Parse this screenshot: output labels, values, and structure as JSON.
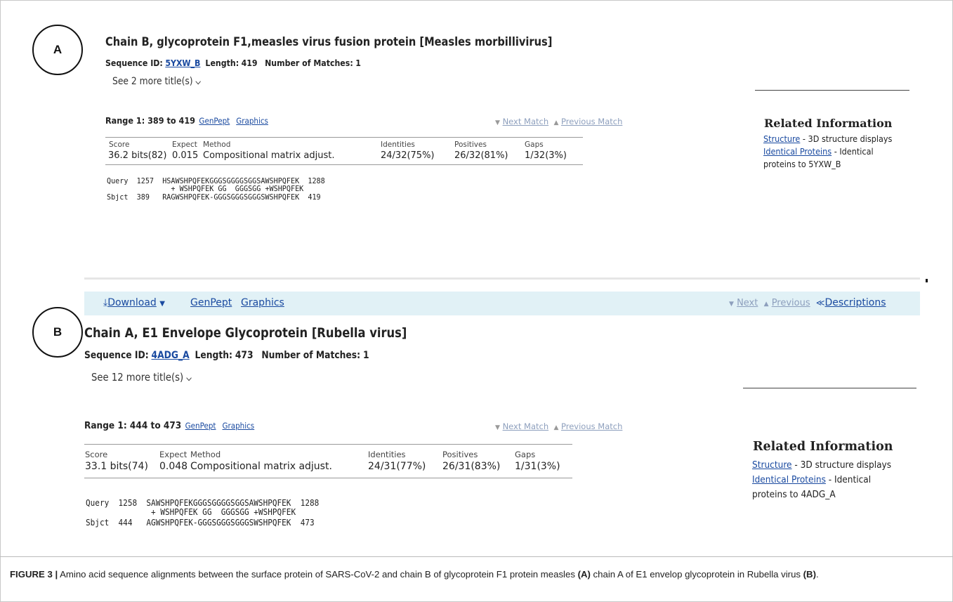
{
  "panel_a": {
    "label": "A",
    "title": "Chain B, glycoprotein F1,measles virus fusion protein [Measles morbillivirus]",
    "seq_id_label": "Sequence ID:",
    "seq_id": "5YXW_B",
    "length_label": "Length:",
    "length": "419",
    "matches_label": "Number of Matches:",
    "matches": "1",
    "see_more": "See 2 more title(s)",
    "range_label": "Range 1: 389 to 419",
    "genpept": "GenPept",
    "graphics": "Graphics",
    "next_match": "Next Match",
    "previous_match": "Previous Match",
    "stats_headers": [
      "Score",
      "Expect",
      "Method",
      "Identities",
      "Positives",
      "Gaps"
    ],
    "stats_values": [
      "36.2 bits(82)",
      "0.015",
      "Compositional matrix adjust.",
      "24/32(75%)",
      "26/32(81%)",
      "1/32(3%)"
    ],
    "alignment": [
      "Query  1257  HSAWSHPQFEKGGGSGGGGSGGSAWSHPQFEK  1288",
      "               + WSHPQFEK GG  GGGSGG +WSHPQFEK",
      "Sbjct  389   RAGWSHPQFEK-GGGSGGGSGGGSWSHPQFEK  419"
    ],
    "related_title": "Related Information",
    "related_structure": "Structure",
    "related_structure_desc": " - 3D structure displays",
    "related_identical": "Identical Proteins",
    "related_identical_desc": " - Identical",
    "related_identical_desc2": "proteins to 5YXW_B"
  },
  "toolbar": {
    "download": "Download",
    "genpept": "GenPept",
    "graphics": "Graphics",
    "next": "Next",
    "previous": "Previous",
    "descriptions": "Descriptions"
  },
  "panel_b": {
    "label": "B",
    "title": "Chain A, E1 Envelope Glycoprotein [Rubella virus]",
    "seq_id_label": "Sequence ID:",
    "seq_id": "4ADG_A",
    "length_label": "Length:",
    "length": "473",
    "matches_label": "Number of Matches:",
    "matches": "1",
    "see_more": "See 12 more title(s)",
    "range_label": "Range 1: 444 to 473",
    "genpept": "GenPept",
    "graphics": "Graphics",
    "next_match": "Next Match",
    "previous_match": "Previous Match",
    "stats_headers": [
      "Score",
      "Expect",
      "Method",
      "Identities",
      "Positives",
      "Gaps"
    ],
    "stats_values": [
      "33.1 bits(74)",
      "0.048",
      "Compositional matrix adjust.",
      "24/31(77%)",
      "26/31(83%)",
      "1/31(3%)"
    ],
    "alignment": [
      "Query  1258  SAWSHPQFEKGGGSGGGGSGGSAWSHPQFEK  1288",
      "              + WSHPQFEK GG  GGGSGG +WSHPQFEK",
      "Sbjct  444   AGWSHPQFEK-GGGSGGGSGGGSWSHPQFEK  473"
    ],
    "related_title": "Related Information",
    "related_structure": "Structure",
    "related_structure_desc": " - 3D structure displays",
    "related_identical": "Identical Proteins",
    "related_identical_desc": " - Identical",
    "related_identical_desc2": "proteins to 4ADG_A"
  },
  "caption": {
    "figure": "FIGURE 3 |",
    "text1": " Amino acid sequence alignments between the surface protein of SARS-CoV-2 and chain B of glycoprotein F1 protein measles ",
    "a": "(A)",
    "text2": " chain A of E1 envelop glycoprotein in Rubella virus ",
    "b": "(B)",
    "text3": "."
  }
}
